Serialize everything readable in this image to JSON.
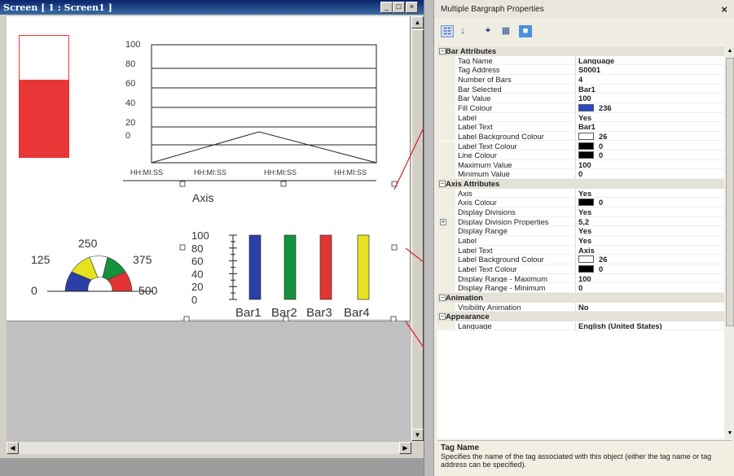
{
  "window": {
    "title": "Screen [ 1 : Screen1 ]",
    "min": "_",
    "max": "□",
    "close": "×"
  },
  "trend": {
    "yticks": [
      "100",
      "80",
      "60",
      "40",
      "20",
      "0"
    ],
    "xticks": [
      "HH:MI:SS",
      "HH:MI:SS",
      "HH:MI:SS",
      "HH:MI:SS"
    ]
  },
  "gauge": {
    "labels": [
      "125",
      "250",
      "375",
      "0",
      "500"
    ]
  },
  "chart_data": {
    "type": "bar",
    "title": "Axis",
    "categories": [
      "Bar1",
      "Bar2",
      "Bar3",
      "Bar4"
    ],
    "values": [
      100,
      100,
      100,
      100
    ],
    "yticks": [
      "100",
      "80",
      "60",
      "40",
      "20",
      "0"
    ],
    "ylim": [
      0,
      100
    ],
    "colors": [
      "#2b3fa6",
      "#13913c",
      "#e33434",
      "#e6e21f"
    ]
  },
  "panel": {
    "title": "Multiple Bargraph Properties",
    "close": "×",
    "rows": [
      {
        "cat": "Bar Attributes"
      },
      {
        "name": "Tag Name",
        "value": "Language"
      },
      {
        "name": "Tag Address",
        "value": "S0001"
      },
      {
        "name": "Number of Bars",
        "value": "4"
      },
      {
        "name": "Bar Selected",
        "value": "Bar1"
      },
      {
        "name": "Bar Value",
        "value": "100"
      },
      {
        "name": "Fill Colour",
        "value": "236",
        "swatch": "#2b49c9"
      },
      {
        "name": "Label",
        "value": "Yes"
      },
      {
        "name": "Label Text",
        "value": "Bar1"
      },
      {
        "name": "Label Background Colour",
        "value": "26",
        "swatch": "#ffffff"
      },
      {
        "name": "Label Text Colour",
        "value": "0",
        "swatch": "#000000"
      },
      {
        "name": "Line Colour",
        "value": "0",
        "swatch": "#000000"
      },
      {
        "name": "Maximum Value",
        "value": "100"
      },
      {
        "name": "Minimum Value",
        "value": "0"
      },
      {
        "cat": "Axis Attributes"
      },
      {
        "name": "Axis",
        "value": "Yes"
      },
      {
        "name": "Axis Colour",
        "value": "0",
        "swatch": "#000000"
      },
      {
        "name": "Display Divisions",
        "value": "Yes"
      },
      {
        "name": "Display Division Properties",
        "value": "5,2",
        "expand": true
      },
      {
        "name": "Display Range",
        "value": "Yes"
      },
      {
        "name": "Label",
        "value": "Yes"
      },
      {
        "name": "Label Text",
        "value": "Axis"
      },
      {
        "name": "Label Background Colour",
        "value": "26",
        "swatch": "#ffffff"
      },
      {
        "name": "Label Text Colour",
        "value": "0",
        "swatch": "#000000"
      },
      {
        "name": "Display Range - Maximum",
        "value": "100"
      },
      {
        "name": "Display Range - Minimum",
        "value": "0"
      },
      {
        "cat": "Animation"
      },
      {
        "name": "Visibility Animation",
        "value": "No"
      },
      {
        "cat": "Appearance"
      },
      {
        "name": "Language",
        "value": "English (United States)"
      }
    ],
    "desc_title": "Tag Name",
    "desc_text": "Specifies the name of the tag associated with this object (either the tag name or tag address can be specified)."
  }
}
